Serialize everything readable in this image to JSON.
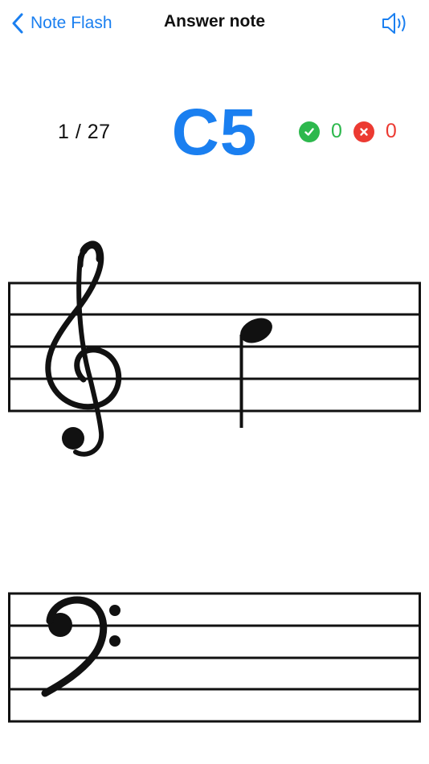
{
  "nav": {
    "back_label": "Note Flash",
    "title": "Answer note",
    "sound_icon": "speaker-icon"
  },
  "status": {
    "counter": "1 / 27",
    "note_name": "C5",
    "correct_count": "0",
    "wrong_count": "0",
    "correct_icon": "checkmark-circle-icon",
    "wrong_icon": "x-circle-icon"
  },
  "treble_staff": {
    "clef": "treble-clef-icon",
    "note": "C5"
  },
  "bass_staff": {
    "clef": "bass-clef-icon"
  },
  "colors": {
    "accent": "#1a7ff0",
    "correct": "#2db84d",
    "wrong": "#ec3a32",
    "ink": "#111111"
  }
}
